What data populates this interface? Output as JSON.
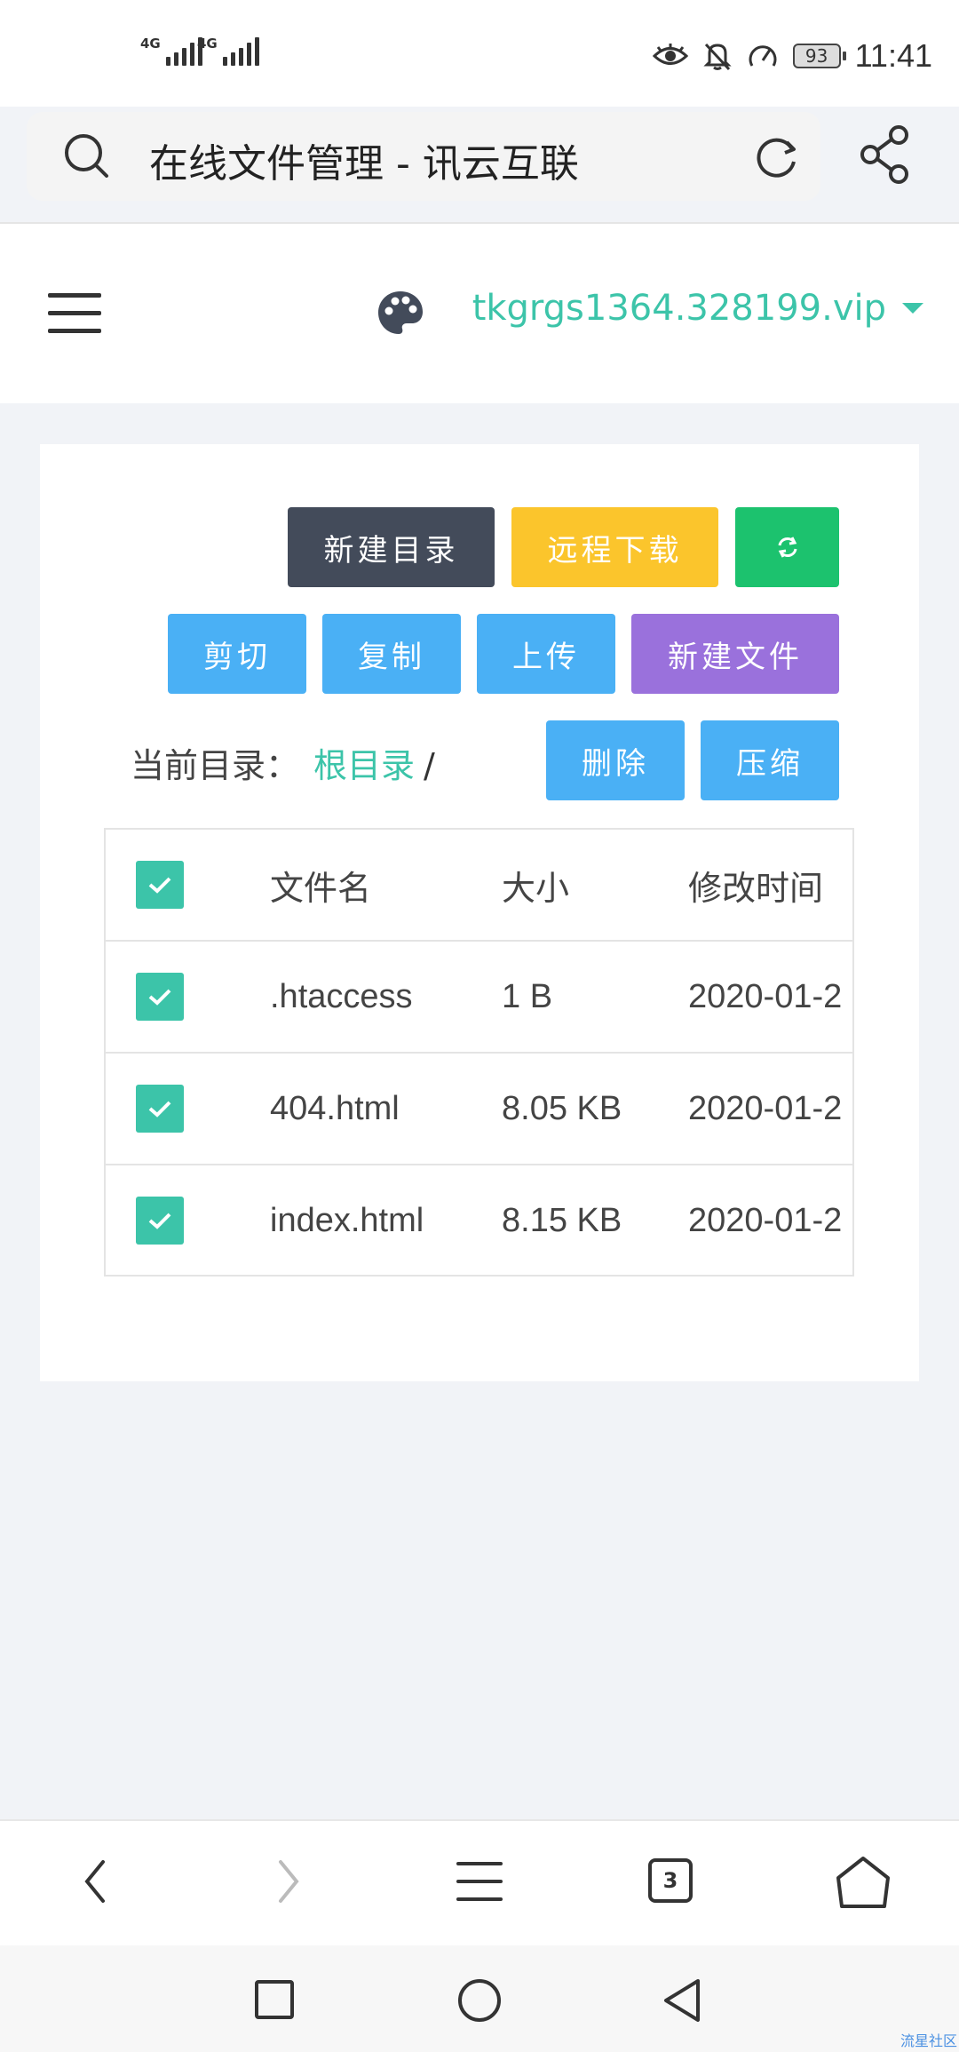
{
  "status_bar": {
    "network_1": "4G",
    "network_2": "4G",
    "battery": "93",
    "time": "11:41"
  },
  "address_bar": {
    "title": "在线文件管理 - 讯云互联",
    "icons": [
      "search-icon",
      "reload-icon",
      "share-icon"
    ]
  },
  "header": {
    "domain": "tkgrgs1364.328199.vip",
    "icons": [
      "menu-icon",
      "palette-icon",
      "caret-down-icon"
    ]
  },
  "toolbar": {
    "new_dir": "新建目录",
    "remote_download": "远程下载",
    "refresh_icon": "refresh-icon",
    "cut": "剪切",
    "copy": "复制",
    "upload": "上传",
    "new_file": "新建文件",
    "delete": "删除",
    "compress": "压缩"
  },
  "current_dir": {
    "label": "当前目录：",
    "root": "根目录",
    "separator": "/"
  },
  "table": {
    "headers": [
      "文件名",
      "大小",
      "修改时间"
    ],
    "rows": [
      {
        "name": ".htaccess",
        "size": "1 B",
        "modified": "2020-01-2"
      },
      {
        "name": "404.html",
        "size": "8.05 KB",
        "modified": "2020-01-2"
      },
      {
        "name": "index.html",
        "size": "8.15 KB",
        "modified": "2020-01-2"
      }
    ]
  },
  "browser_bar": {
    "tab_count": "3"
  },
  "colors": {
    "accent": "#3cc4a9",
    "dark_button": "#434b5a",
    "yellow_button": "#fbc52c",
    "green_button": "#1cc26e",
    "blue_button": "#4ab0f5",
    "purple_button": "#9a71dc",
    "page_bg": "#f1f3f7"
  },
  "watermark": "流星社区"
}
